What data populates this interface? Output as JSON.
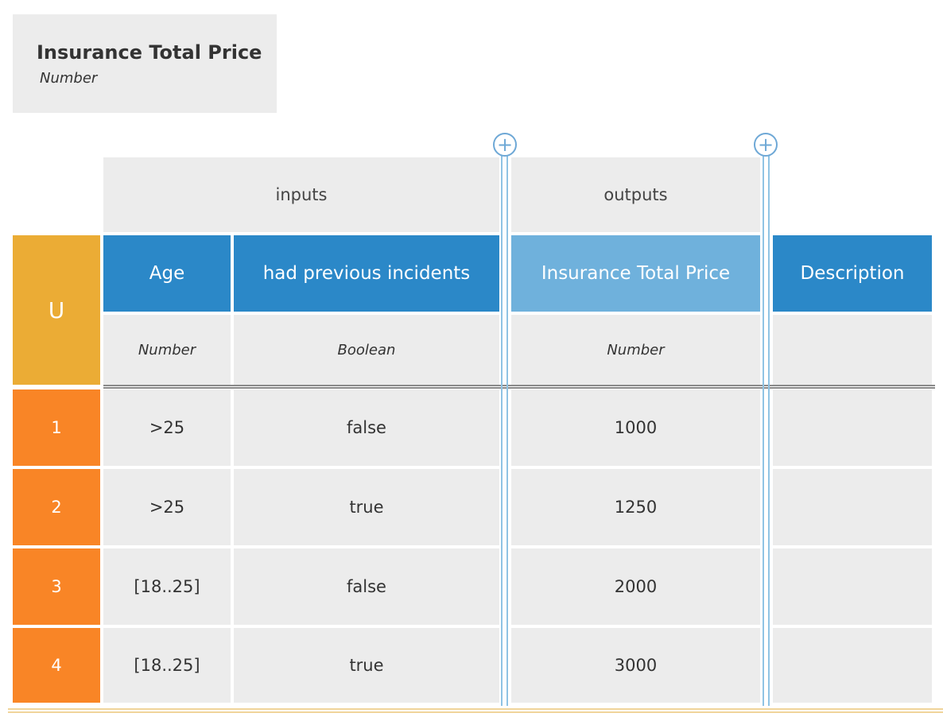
{
  "decision": {
    "name": "Insurance Total Price",
    "type": "Number"
  },
  "groups": {
    "inputs": "inputs",
    "outputs": "outputs"
  },
  "hit_policy": "U",
  "columns": {
    "age": {
      "label": "Age",
      "type": "Number"
    },
    "incidents": {
      "label": "had previous incidents",
      "type": "Boolean"
    },
    "price": {
      "label": "Insurance Total Price",
      "type": "Number"
    },
    "description": {
      "label": "Description",
      "type": ""
    }
  },
  "rows": [
    {
      "num": "1",
      "age": ">25",
      "incidents": "false",
      "price": "1000",
      "description": ""
    },
    {
      "num": "2",
      "age": ">25",
      "incidents": "true",
      "price": "1250",
      "description": ""
    },
    {
      "num": "3",
      "age": "[18..25]",
      "incidents": "false",
      "price": "2000",
      "description": ""
    },
    {
      "num": "4",
      "age": "[18..25]",
      "incidents": "true",
      "price": "3000",
      "description": ""
    }
  ],
  "add_buttons": {
    "input": "+",
    "output": "+"
  },
  "colors": {
    "hit_policy": "#ebac35",
    "input_header": "#2b88c8",
    "output_header": "#6fb1dc",
    "row_number": "#f98526",
    "cell": "#ececec"
  }
}
